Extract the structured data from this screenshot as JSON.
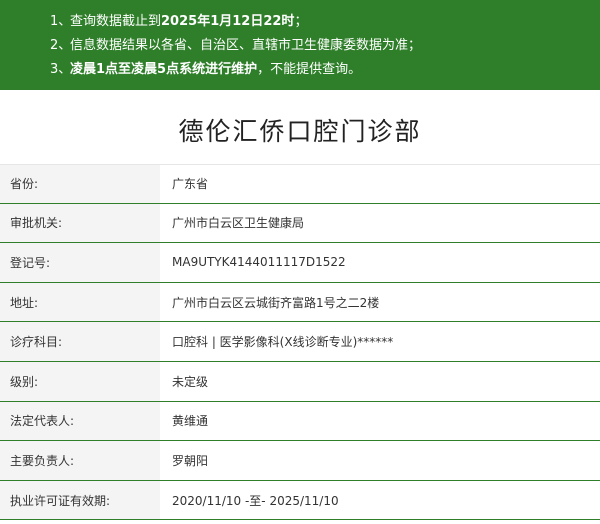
{
  "notice": {
    "lines": [
      {
        "num": "1、",
        "pre": "查询数据截止到",
        "bold": "2025年1月12日22时",
        "post": "；"
      },
      {
        "num": "2、",
        "pre": "信息数据结果以各省、自治区、直辖市卫生健康委数据为准；",
        "bold": "",
        "post": ""
      },
      {
        "num": "3、",
        "pre": "",
        "bold": "凌晨1点至凌晨5点系统进行维护",
        "post": "，不能提供查询。"
      }
    ]
  },
  "title": "德伦汇侨口腔门诊部",
  "rows": [
    {
      "label": "省份:",
      "value": "广东省"
    },
    {
      "label": "审批机关:",
      "value": "广州市白云区卫生健康局"
    },
    {
      "label": "登记号:",
      "value": "MA9UTYK4144011117D1522"
    },
    {
      "label": "地址:",
      "value": "广州市白云区云城街齐富路1号之二2楼"
    },
    {
      "label": "诊疗科目:",
      "value": "口腔科 | 医学影像科(X线诊断专业)******"
    },
    {
      "label": "级别:",
      "value": "未定级"
    },
    {
      "label": "法定代表人:",
      "value": "黄维通"
    },
    {
      "label": "主要负责人:",
      "value": "罗朝阳"
    },
    {
      "label": "执业许可证有效期:",
      "value": "2020/11/10 -至- 2025/11/10"
    }
  ]
}
